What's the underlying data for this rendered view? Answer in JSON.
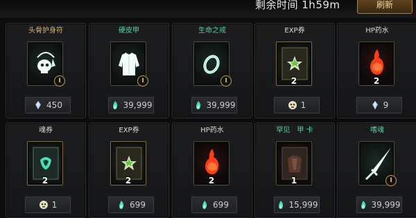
{
  "header": {
    "timer_text": "剩余时间 1h59m",
    "refresh_label": "刷新"
  },
  "colors": {
    "title_gold": "#d9b46a",
    "title_green": "#56d0a9",
    "accent_button": "#a9803f"
  },
  "items": [
    {
      "title": "头骨护身符",
      "title_color": "gold",
      "icon": "skull-amulet-icon",
      "count": "",
      "tier": "I",
      "price": "450",
      "currency": "blue-crystal-icon"
    },
    {
      "title": "硬皮甲",
      "title_color": "green",
      "icon": "leather-armor-icon",
      "count": "",
      "tier": "I",
      "price": "39,999",
      "currency": "green-flame-icon"
    },
    {
      "title": "生命之戒",
      "title_color": "green",
      "icon": "life-ring-icon",
      "count": "",
      "tier": "I",
      "price": "39,999",
      "currency": "green-flame-icon"
    },
    {
      "title": "EXP券",
      "title_color": "white",
      "icon": "exp-ticket-icon",
      "count": "2",
      "tier": "",
      "price": "1",
      "currency": "skull-coin-icon"
    },
    {
      "title": "HP药水",
      "title_color": "white",
      "icon": "hp-potion-icon",
      "count": "2",
      "tier": "",
      "price": "9",
      "currency": "blue-crystal-icon"
    },
    {
      "title": "魂券",
      "title_color": "white",
      "icon": "soul-ticket-icon",
      "count": "2",
      "tier": "",
      "price": "1",
      "currency": "skull-coin-icon"
    },
    {
      "title": "EXP券",
      "title_color": "white",
      "icon": "exp-ticket-icon",
      "count": "2",
      "tier": "",
      "price": "699",
      "currency": "green-flame-icon"
    },
    {
      "title": "HP药水",
      "title_color": "white",
      "icon": "hp-potion-icon",
      "count": "2",
      "tier": "",
      "price": "699",
      "currency": "green-flame-icon"
    },
    {
      "title": "罕见　甲 卡",
      "title_color": "green",
      "icon": "armor-card-icon",
      "count": "1",
      "tier": "",
      "price": "15,999",
      "currency": "green-flame-icon"
    },
    {
      "title": "嗜魂",
      "title_color": "green",
      "icon": "soul-blade-icon",
      "count": "",
      "tier": "I",
      "price": "39,999",
      "currency": "green-flame-icon"
    }
  ]
}
